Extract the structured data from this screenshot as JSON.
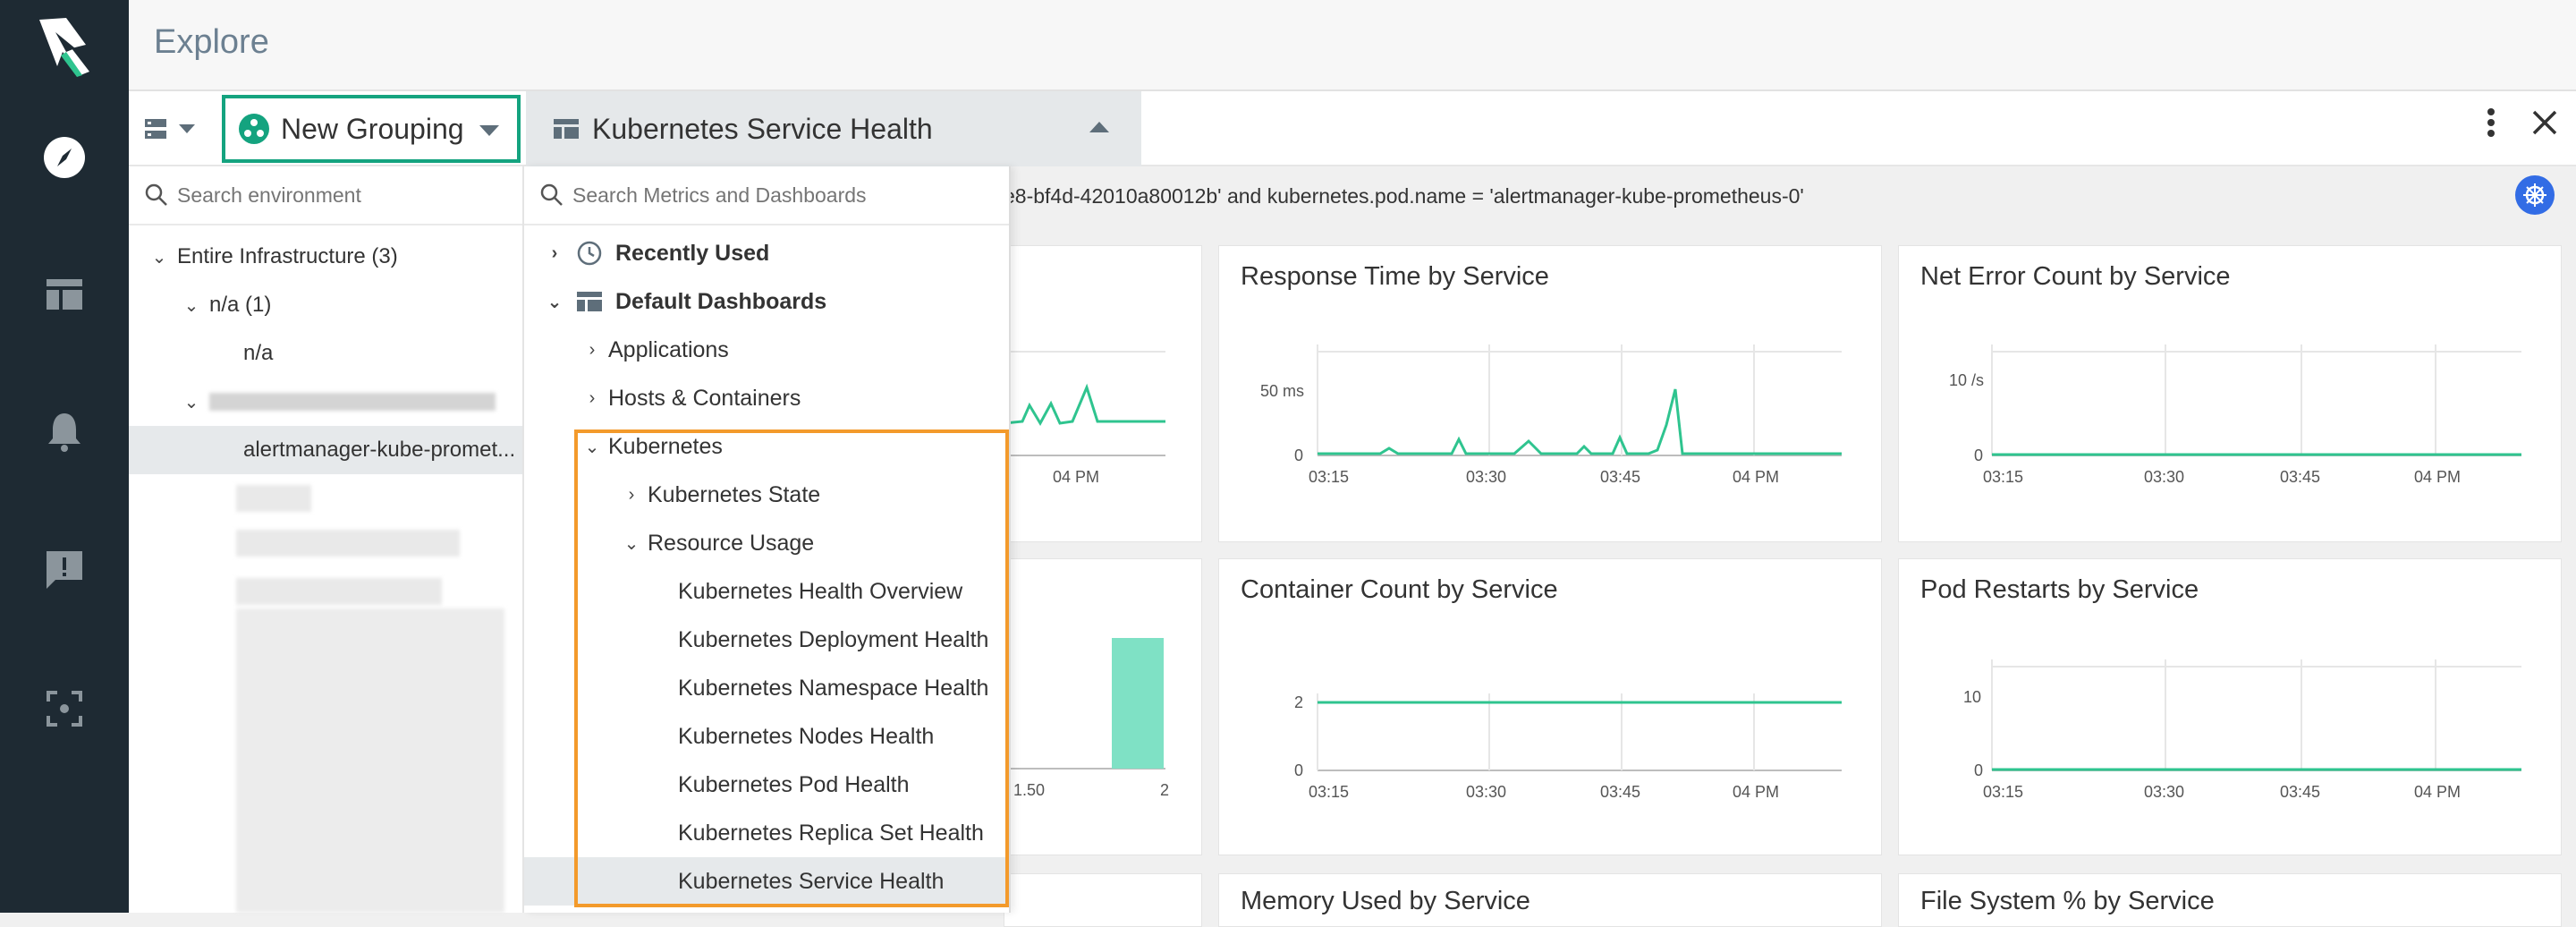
{
  "app": {
    "page_title": "Explore"
  },
  "nav": {
    "items": [
      {
        "name": "explore",
        "icon": "compass-icon"
      },
      {
        "name": "dashboards",
        "icon": "dashboard-icon"
      },
      {
        "name": "alerts",
        "icon": "bell-icon"
      },
      {
        "name": "events",
        "icon": "alert-message-icon"
      },
      {
        "name": "capture",
        "icon": "capture-icon"
      }
    ]
  },
  "toolbar": {
    "grouping_label": "New Grouping",
    "dashboard_label": "Kubernetes Service Health"
  },
  "filter_text": "e8-bf4d-42010a80012b' and kubernetes.pod.name = 'alertmanager-kube-prometheus-0'",
  "env": {
    "search_placeholder": "Search environment",
    "tree": [
      {
        "label": "Entire Infrastructure (3)",
        "chev": "v"
      },
      {
        "label": "n/a (1)",
        "chev": "v"
      },
      {
        "label": "n/a",
        "chev": ""
      },
      {
        "label": "",
        "chev": "v"
      },
      {
        "label": "alertmanager-kube-promet...",
        "chev": ""
      }
    ]
  },
  "dashboards": {
    "search_placeholder": "Search Metrics and Dashboards",
    "recently_used": "Recently Used",
    "default_dashboards": "Default Dashboards",
    "applications": "Applications",
    "hosts_containers": "Hosts & Containers",
    "kubernetes": "Kubernetes",
    "kubernetes_state": "Kubernetes State",
    "resource_usage": "Resource Usage",
    "items": [
      "Kubernetes Health Overview",
      "Kubernetes Deployment Health",
      "Kubernetes Namespace Health",
      "Kubernetes Nodes Health",
      "Kubernetes Pod Health",
      "Kubernetes Replica Set Health",
      "Kubernetes Service Health"
    ]
  },
  "panels": {
    "response_time": {
      "title": "Response Time by Service",
      "y_top": "50 ms",
      "y_zero": "0"
    },
    "net_error": {
      "title": "Net Error Count by Service",
      "y_top": "10 /s",
      "y_zero": "0"
    },
    "container_count": {
      "title": "Container Count by Service",
      "y_top": "2",
      "y_zero": "0"
    },
    "pod_restarts": {
      "title": "Pod Restarts by Service",
      "y_top": "10",
      "y_zero": "0"
    },
    "memory_used": {
      "title": "Memory Used by Service"
    },
    "file_system": {
      "title": "File System % by Service"
    },
    "partial_top_xlabel": "04 PM",
    "partial_bar_x1": "1.50",
    "partial_bar_x2": "2",
    "time_ticks": [
      "03:15",
      "03:30",
      "03:45",
      "04 PM"
    ]
  },
  "colors": {
    "accent": "#14a37f",
    "series": "#2fc48f",
    "highlight": "#f39a2b",
    "nav_bg": "#1e2a33"
  }
}
